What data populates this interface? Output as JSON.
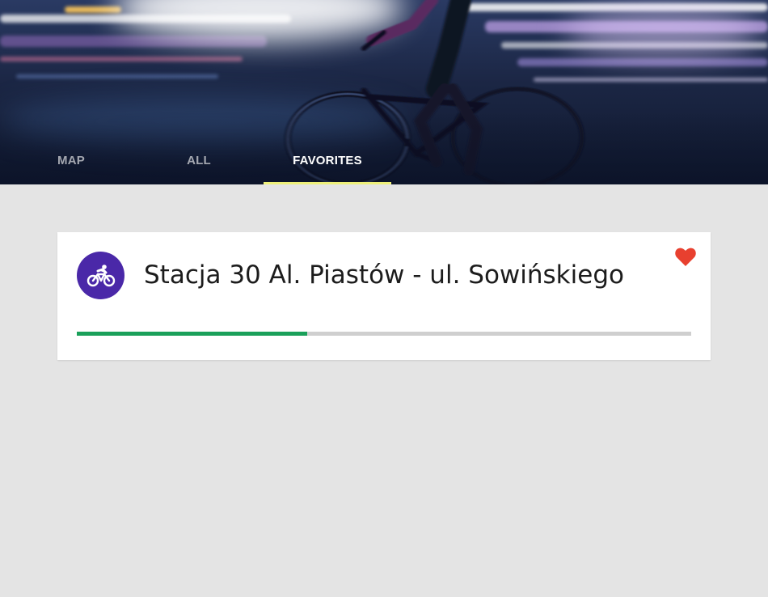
{
  "header": {
    "tabs": [
      {
        "label": "MAP",
        "active": false
      },
      {
        "label": "ALL",
        "active": false
      },
      {
        "label": "FAVORITES",
        "active": true
      }
    ],
    "indicator_color": "#eef07a"
  },
  "favorites": {
    "stations": [
      {
        "name": "Stacja 30 Al. Piastów - ul. Sowińskiego",
        "icon": "bike-icon",
        "icon_bg": "#4a28a8",
        "favorite": true,
        "favorite_icon": "heart-icon",
        "favorite_color": "#e8402f",
        "availability_fraction": 0.375,
        "availability_color": "#1aa05a",
        "track_color": "#cfcfcf"
      }
    ]
  },
  "colors": {
    "background": "#e4e4e4",
    "card": "#ffffff"
  }
}
